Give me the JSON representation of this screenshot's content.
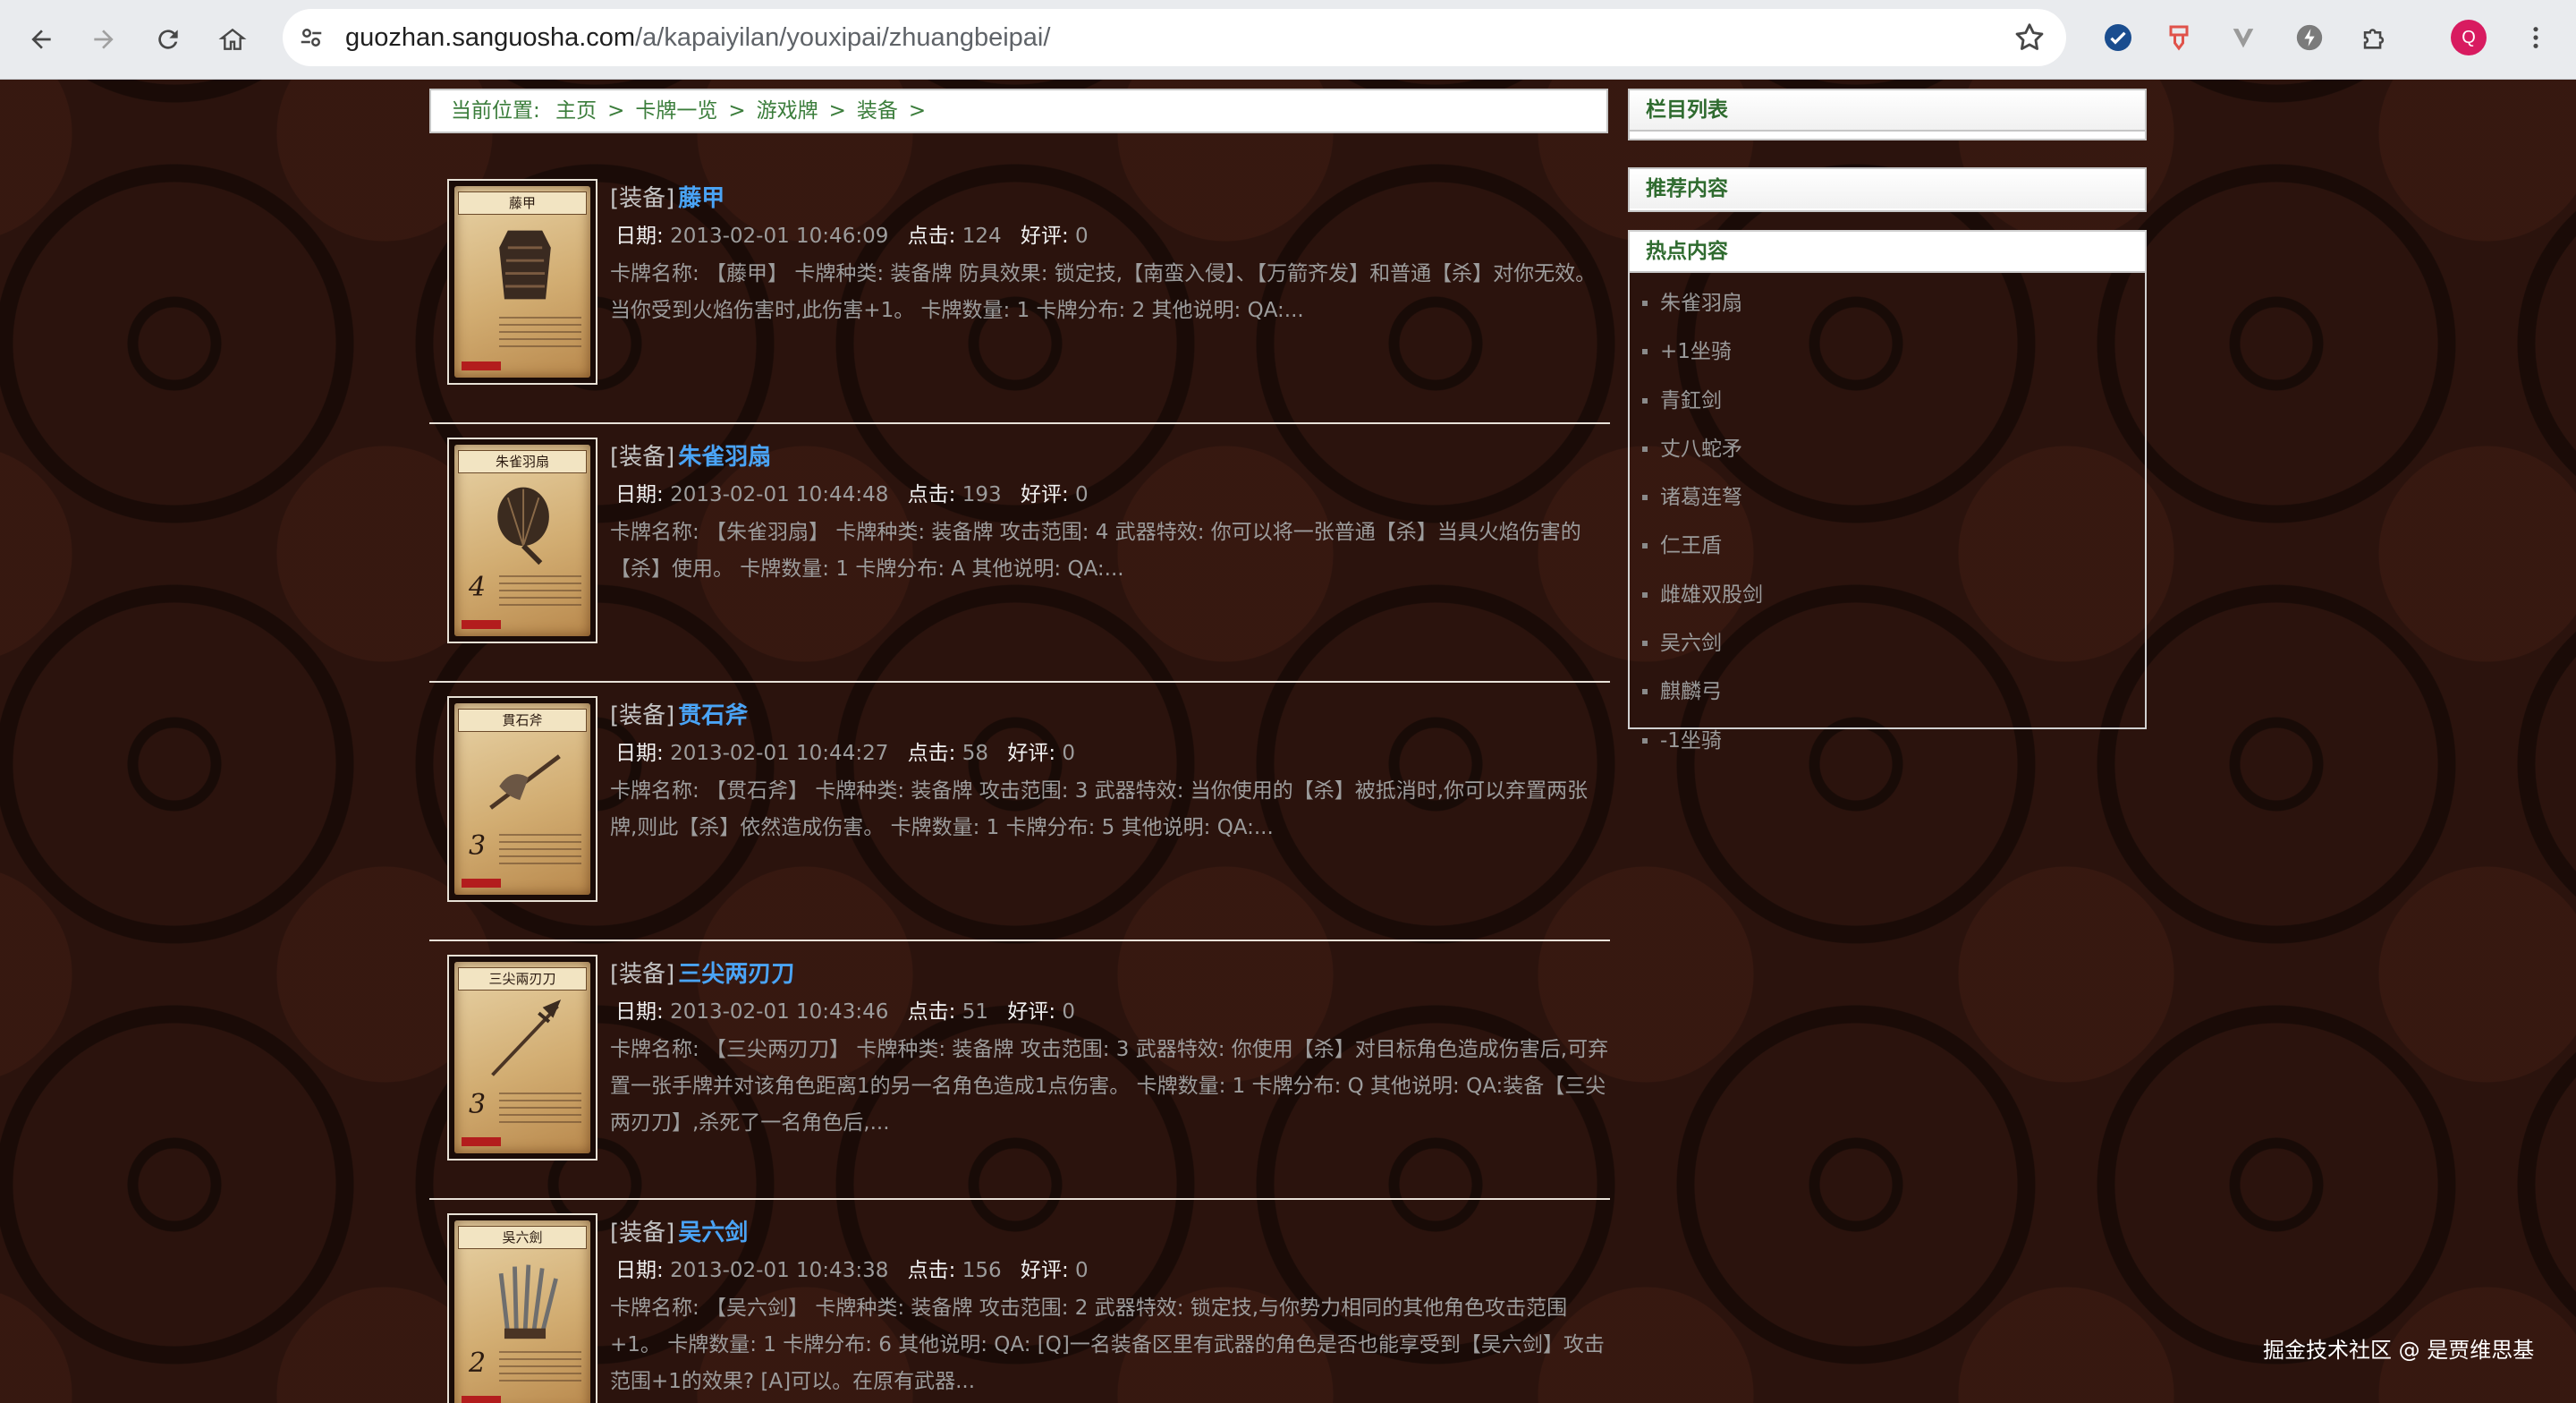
{
  "browser": {
    "url_host": "guozhan.sanguosha.com",
    "url_path": "/a/kapaiyilan/youxipai/zhuangbeipai/",
    "profile_initial": "Q"
  },
  "breadcrumb": {
    "label": "当前位置:",
    "items": [
      "主页",
      "卡牌一览",
      "游戏牌",
      "装备"
    ],
    "separator": ">"
  },
  "meta_labels": {
    "date": "日期:",
    "clicks": "点击:",
    "likes": "好评:"
  },
  "articles": [
    {
      "category": "[装备]",
      "title": "藤甲",
      "card_name": "藤甲",
      "card_num": "",
      "date": "2013-02-01 10:46:09",
      "clicks": "124",
      "likes": "0",
      "desc": "卡牌名称: 【藤甲】 卡牌种类: 装备牌 防具效果: 锁定技,【南蛮入侵】、【万箭齐发】和普通【杀】对你无效。当你受到火焰伤害时,此伤害+1。 卡牌数量: 1 卡牌分布: 2 其他说明: QA:..."
    },
    {
      "category": "[装备]",
      "title": "朱雀羽扇",
      "card_name": "朱雀羽扇",
      "card_num": "4",
      "date": "2013-02-01 10:44:48",
      "clicks": "193",
      "likes": "0",
      "desc": "卡牌名称: 【朱雀羽扇】 卡牌种类: 装备牌 攻击范围: 4 武器特效: 你可以将一张普通【杀】当具火焰伤害的【杀】使用。 卡牌数量: 1 卡牌分布: A 其他说明: QA:..."
    },
    {
      "category": "[装备]",
      "title": "贯石斧",
      "card_name": "貫石斧",
      "card_num": "3",
      "date": "2013-02-01 10:44:27",
      "clicks": "58",
      "likes": "0",
      "desc": "卡牌名称: 【贯石斧】 卡牌种类: 装备牌 攻击范围: 3 武器特效: 当你使用的【杀】被抵消时,你可以弃置两张牌,则此【杀】依然造成伤害。 卡牌数量: 1 卡牌分布: 5 其他说明: QA:..."
    },
    {
      "category": "[装备]",
      "title": "三尖两刃刀",
      "card_name": "三尖兩刃刀",
      "card_num": "3",
      "date": "2013-02-01 10:43:46",
      "clicks": "51",
      "likes": "0",
      "desc": "卡牌名称: 【三尖两刃刀】 卡牌种类: 装备牌 攻击范围: 3 武器特效: 你使用【杀】对目标角色造成伤害后,可弃置一张手牌并对该角色距离1的另一名角色造成1点伤害。 卡牌数量: 1 卡牌分布: Q 其他说明: QA:装备【三尖两刃刀】,杀死了一名角色后,..."
    },
    {
      "category": "[装备]",
      "title": "吴六剑",
      "card_name": "吳六劍",
      "card_num": "2",
      "date": "2013-02-01 10:43:38",
      "clicks": "156",
      "likes": "0",
      "desc": "卡牌名称: 【吴六剑】 卡牌种类: 装备牌 攻击范围: 2 武器特效: 锁定技,与你势力相同的其他角色攻击范围+1。 卡牌数量: 1 卡牌分布: 6 其他说明: QA: [Q]一名装备区里有武器的角色是否也能享受到【吴六剑】攻击范围+1的效果? [A]可以。在原有武器..."
    }
  ],
  "sidebar": {
    "column_list": "栏目列表",
    "recommended": "推荐内容",
    "hot": "热点内容",
    "hot_items": [
      "朱雀羽扇",
      "+1坐骑",
      "青釭剑",
      "丈八蛇矛",
      "诸葛连弩",
      "仁王盾",
      "雌雄双股剑",
      "吴六剑",
      "麒麟弓",
      "-1坐骑"
    ]
  },
  "watermark": "掘金技术社区 @ 是贾维思基"
}
